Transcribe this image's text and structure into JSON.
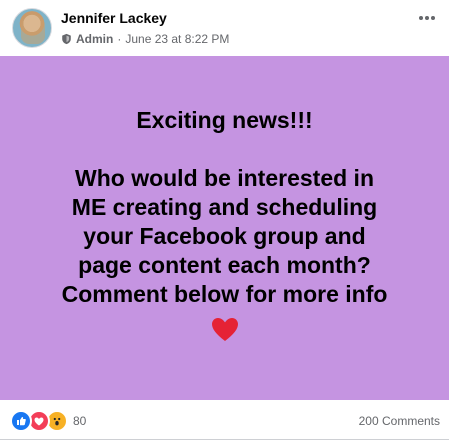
{
  "post": {
    "author": "Jennifer Lackey",
    "role": "Admin",
    "separator": "·",
    "timestamp": "June 23 at 8:22 PM",
    "more_label": "More options",
    "headline": "Exciting news!!!",
    "body_lines": [
      "Who would be interested in",
      "ME creating and scheduling",
      "your Facebook group and",
      "page content each month?",
      "Comment below for more info"
    ],
    "emoji": "♥"
  },
  "footer": {
    "reaction_count": "80",
    "comments": "200 Comments"
  },
  "icons": {
    "role_badge": "shield-icon",
    "more": "more-icon",
    "reactions": [
      "like-icon",
      "love-icon",
      "wow-icon"
    ],
    "emoji": "heart-icon"
  },
  "colors": {
    "background": "#c594e1",
    "text": "#000000",
    "accent": "#1877f2",
    "love": "#f33e58",
    "wow": "#f7b125",
    "heart": "#e52235"
  }
}
